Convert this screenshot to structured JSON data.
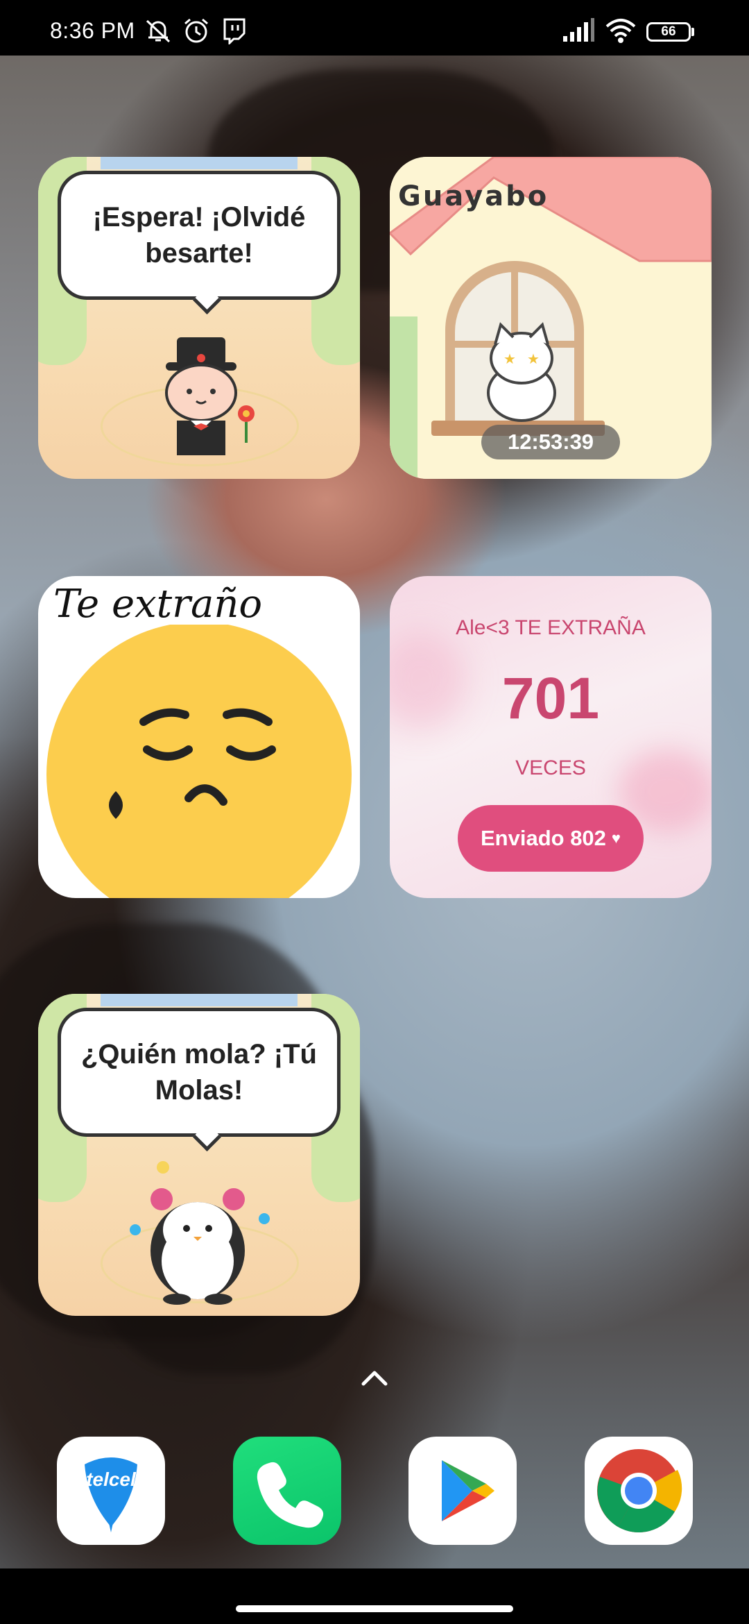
{
  "status_bar": {
    "time": "8:36 PM",
    "left_icons": [
      "mute-icon",
      "alarm-icon",
      "twitch-icon"
    ],
    "right_icons": [
      "signal-icon",
      "wifi-icon",
      "battery-icon"
    ],
    "battery": "66"
  },
  "widgets": {
    "widget1": {
      "speech": "¡Espera! ¡Olvidé besarte!",
      "character": "cat-in-top-hat"
    },
    "widget2": {
      "name": "Guayabo",
      "timer": "12:53:39",
      "character": "cat-in-window"
    },
    "widget3": {
      "caption": "Te extraño",
      "emoji": "crying-face"
    },
    "widget4": {
      "heading": "Ale<3 TE EXTRAÑA",
      "count": "701",
      "unit": "VECES",
      "button": "Enviado 802",
      "accent": "#e04e7e"
    },
    "widget5": {
      "speech": "¿Quién mola? ¡Tú Molas!",
      "character": "penguin"
    }
  },
  "app_drawer_icon": "chevron-up-icon",
  "dock": [
    {
      "name": "Telcel",
      "logo_text": "telcel"
    },
    {
      "name": "Phone"
    },
    {
      "name": "Play Store"
    },
    {
      "name": "Chrome"
    }
  ]
}
